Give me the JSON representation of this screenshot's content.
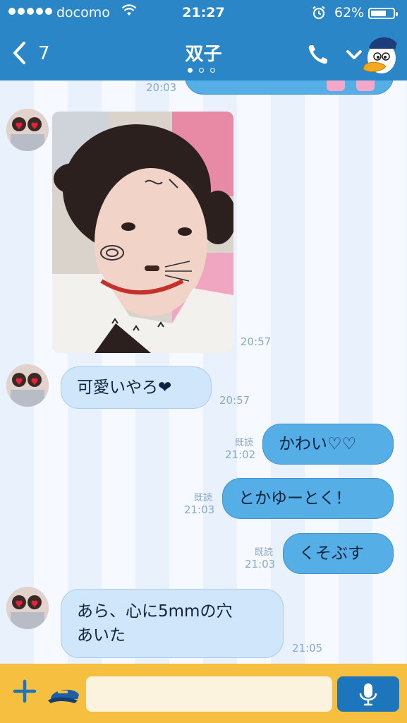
{
  "status_bar": {
    "carrier": "docomo",
    "time": "21:27",
    "battery_percent": "62%",
    "battery_level": 0.62,
    "signal_dots": 5
  },
  "nav": {
    "back_count": "7",
    "title": "双子",
    "page_dots": 3,
    "active_page": 0
  },
  "messages": {
    "top_partial": {
      "time": "20:03",
      "text": ""
    },
    "photo": {
      "time": "20:57"
    },
    "m1": {
      "text": "可愛いやろ❤",
      "time": "20:57"
    },
    "m2": {
      "text": "かわい♡♡",
      "read": "既読",
      "time": "21:02"
    },
    "m3": {
      "text": "とかゆーとく！",
      "read": "既読",
      "time": "21:03"
    },
    "m4": {
      "text": "くそぶす",
      "read": "既読",
      "time": "21:03"
    },
    "m5": {
      "line1": "あら、心に5mmの穴",
      "line2": "あいた",
      "time": "21:05"
    }
  },
  "input": {
    "placeholder": ""
  },
  "colors": {
    "header": "#2b86c8",
    "incoming_bubble": "#cfe6fb",
    "outgoing_bubble": "#56aee6",
    "input_bar": "#f6bf3f",
    "mic_button": "#1d75bb"
  },
  "icons": [
    "back-chevron-icon",
    "phone-icon",
    "chevron-down-icon",
    "donald-duck-avatar-icon",
    "plus-icon",
    "sailor-cap-sticker-icon",
    "microphone-icon",
    "wifi-icon",
    "alarm-icon",
    "battery-icon"
  ]
}
